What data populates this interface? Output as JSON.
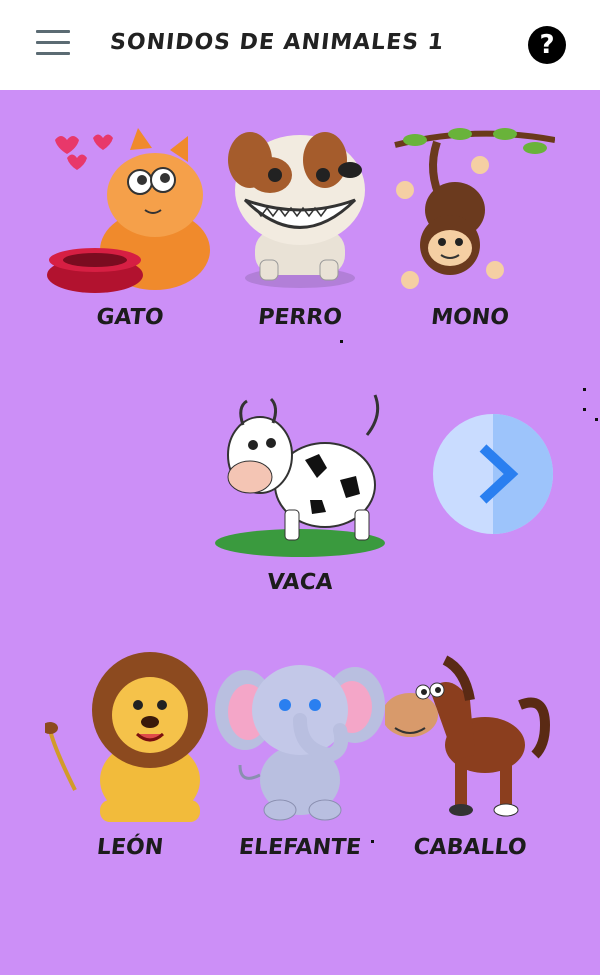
{
  "app": {
    "title": "SONIDOS DE ANIMALES 1",
    "help_symbol": "?"
  },
  "animals": [
    {
      "id": "gato",
      "label": "GATO"
    },
    {
      "id": "perro",
      "label": "PERRO"
    },
    {
      "id": "mono",
      "label": "MONO"
    },
    {
      "id": "vaca",
      "label": "VACA"
    },
    {
      "id": "leon",
      "label": "LEÓN"
    },
    {
      "id": "elefante",
      "label": "ELEFANTE"
    },
    {
      "id": "caballo",
      "label": "CABALLO"
    }
  ],
  "icons": {
    "menu": "menu-icon",
    "help": "help-icon",
    "next": "chevron-right-icon"
  },
  "colors": {
    "background": "#cc8ff7",
    "appbar": "#ffffff",
    "next_button": "#9dc4fb",
    "next_arrow": "#2a7ff0"
  }
}
